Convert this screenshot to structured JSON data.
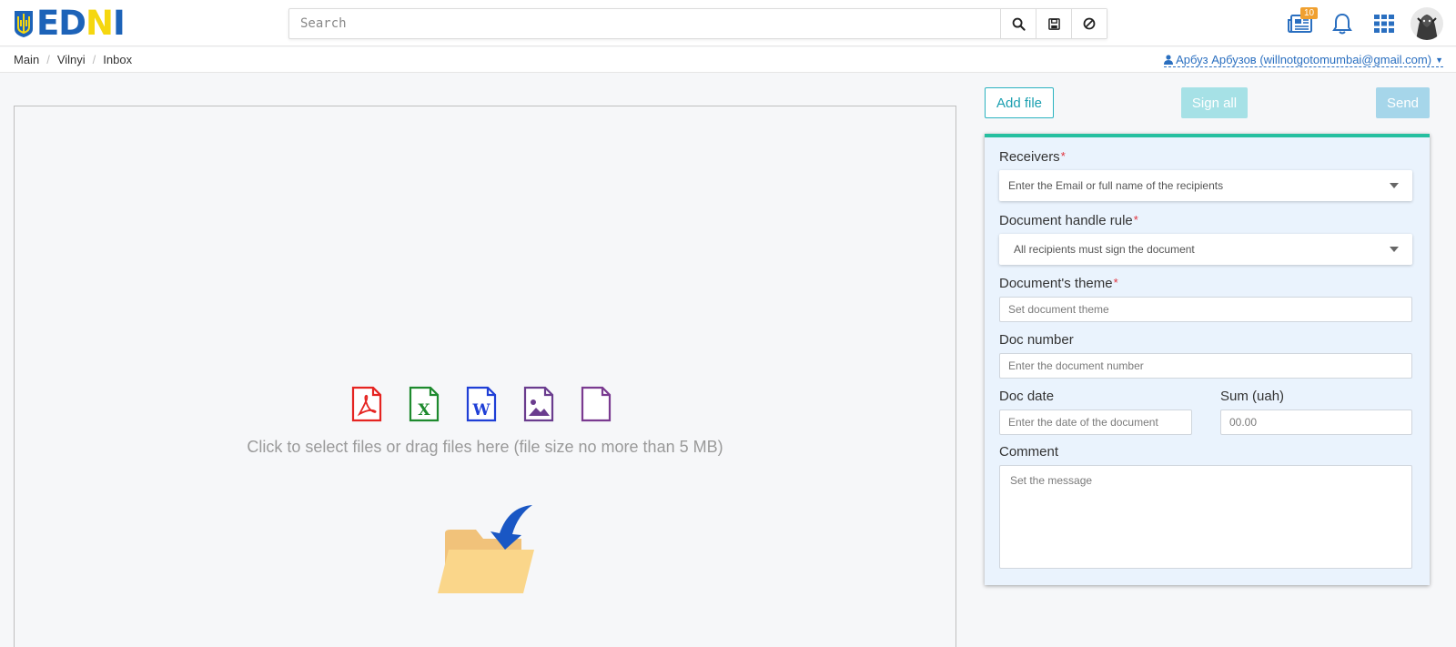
{
  "header": {
    "logo_text_blue": "ED",
    "logo_text_yellow": "N",
    "logo_text_blue2": "I",
    "search_placeholder": "Search",
    "news_badge": "10",
    "icons": [
      "search-icon",
      "save-icon",
      "clear-icon",
      "news-icon",
      "bell-icon",
      "apps-grid-icon"
    ]
  },
  "breadcrumb": {
    "items": [
      "Main",
      "Vilnyi",
      "Inbox"
    ]
  },
  "user": {
    "label": "Арбуз Арбузов (willnotgotomumbai@gmail.com)"
  },
  "dropzone": {
    "text": "Click to select files or drag files here (file size no more than 5 MB)",
    "file_types": [
      "pdf",
      "excel",
      "word",
      "image",
      "generic"
    ],
    "colors": {
      "pdf": "#e52421",
      "excel": "#1e8a2e",
      "word": "#1f3fd6",
      "image": "#6a3c8e",
      "generic": "#7a3a90"
    }
  },
  "actions": {
    "add_file": "Add file",
    "sign_all": "Sign all",
    "send": "Send"
  },
  "form": {
    "receivers_label": "Receivers",
    "receivers_placeholder": "Enter the Email or full name of the recipients",
    "handle_rule_label": "Document handle rule",
    "handle_rule_value": "All recipients must sign the document",
    "theme_label": "Document's theme",
    "theme_placeholder": "Set document theme",
    "doc_number_label": "Doc number",
    "doc_number_placeholder": "Enter the document number",
    "doc_date_label": "Doc date",
    "doc_date_placeholder": "Enter the date of the document",
    "sum_label": "Sum (uah)",
    "sum_placeholder": "00.00",
    "comment_label": "Comment",
    "comment_placeholder": "Set the message",
    "required_mark": "*"
  },
  "colors": {
    "accent": "#25bfa0",
    "brand_blue": "#1d63b8",
    "brand_yellow": "#f5d70f",
    "link": "#2a6fc0"
  }
}
